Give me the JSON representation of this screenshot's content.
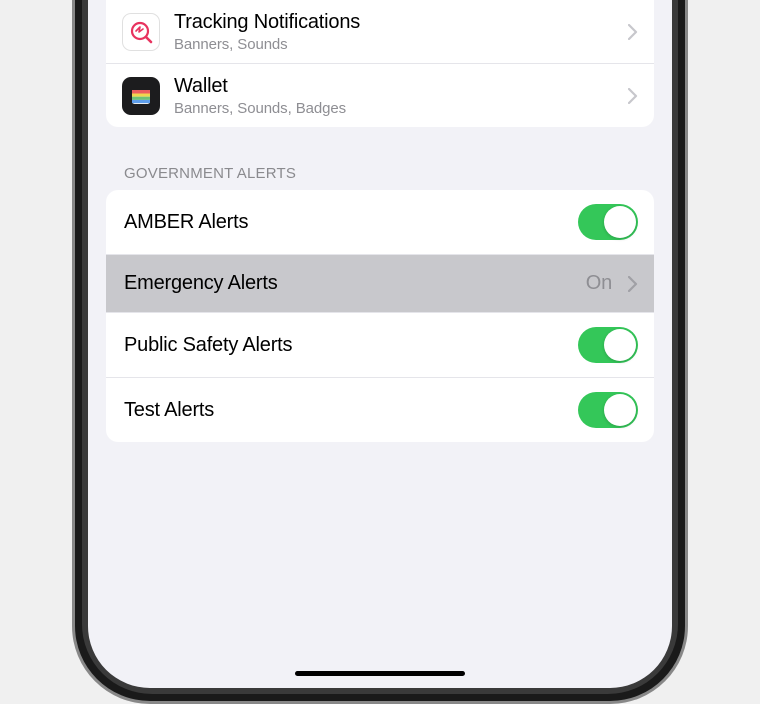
{
  "apps": [
    {
      "title": "Tracking Notifications",
      "subtitle": "Banners, Sounds",
      "icon": "tracking"
    },
    {
      "title": "Wallet",
      "subtitle": "Banners, Sounds, Badges",
      "icon": "wallet"
    }
  ],
  "section_header": "GOVERNMENT ALERTS",
  "alerts": {
    "amber": {
      "label": "AMBER Alerts",
      "on": true
    },
    "emergency": {
      "label": "Emergency Alerts",
      "value": "On"
    },
    "public_safety": {
      "label": "Public Safety Alerts",
      "on": true
    },
    "test": {
      "label": "Test Alerts",
      "on": true
    }
  }
}
